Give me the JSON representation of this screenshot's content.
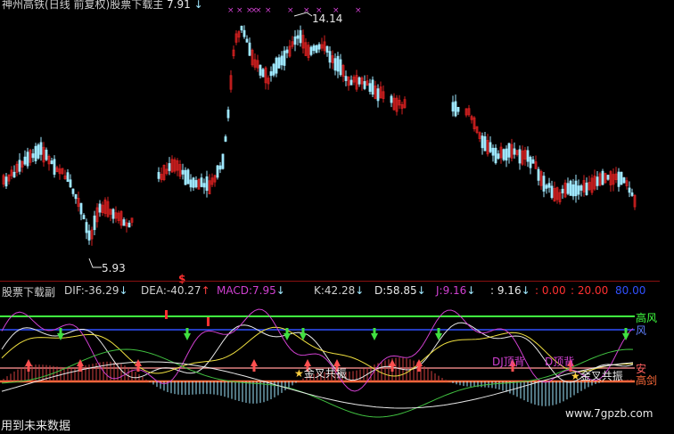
{
  "main_header": {
    "stock": "神州高铁",
    "period_adj": "(日线 前复权)",
    "indicator": "股票下载主",
    "value": "7.91",
    "arrow": "↓"
  },
  "price_labels": {
    "high": "14.14",
    "low": "5.93"
  },
  "sub_header": {
    "name": "股票下载副",
    "dif_label": "DIF:",
    "dif": "-36.29",
    "dif_arrow": "↓",
    "dea_label": "DEA:",
    "dea": "-40.27",
    "dea_arrow": "↑",
    "macd_label": "MACD:",
    "macd": "7.95",
    "macd_arrow": "↓",
    "k_label": "K:",
    "k": "42.28",
    "k_arrow": "↓",
    "d_label": "D:",
    "d": "58.85",
    "d_arrow": "↓",
    "j_label": "J:",
    "j": "9.16",
    "j_arrow": "↓",
    "v1": ": 9.16",
    "v1_arrow": "↓",
    "v2": ": 0.00",
    "v3": ": 20.00",
    "v4": "80.00"
  },
  "annotations": {
    "dollar": "$",
    "golden_cross_1": "金叉共振",
    "golden_cross_2": "金叉共振",
    "dj_top_div": "DJ顶背",
    "d_top_div": "D顶背",
    "right_gao": "高风",
    "right_feng": "风",
    "right_an": "安",
    "right_gao2": "高剑"
  },
  "footer": {
    "left": "用到未来数据",
    "right": "www.7gpzb.com"
  },
  "colors": {
    "up": "#d42020",
    "down": "#9fe8ff",
    "green_line": "#40ff40",
    "blue_line": "#3050ff",
    "magenta": "#d040d0",
    "orange": "#ff6a3a",
    "pink": "#e08080"
  }
}
